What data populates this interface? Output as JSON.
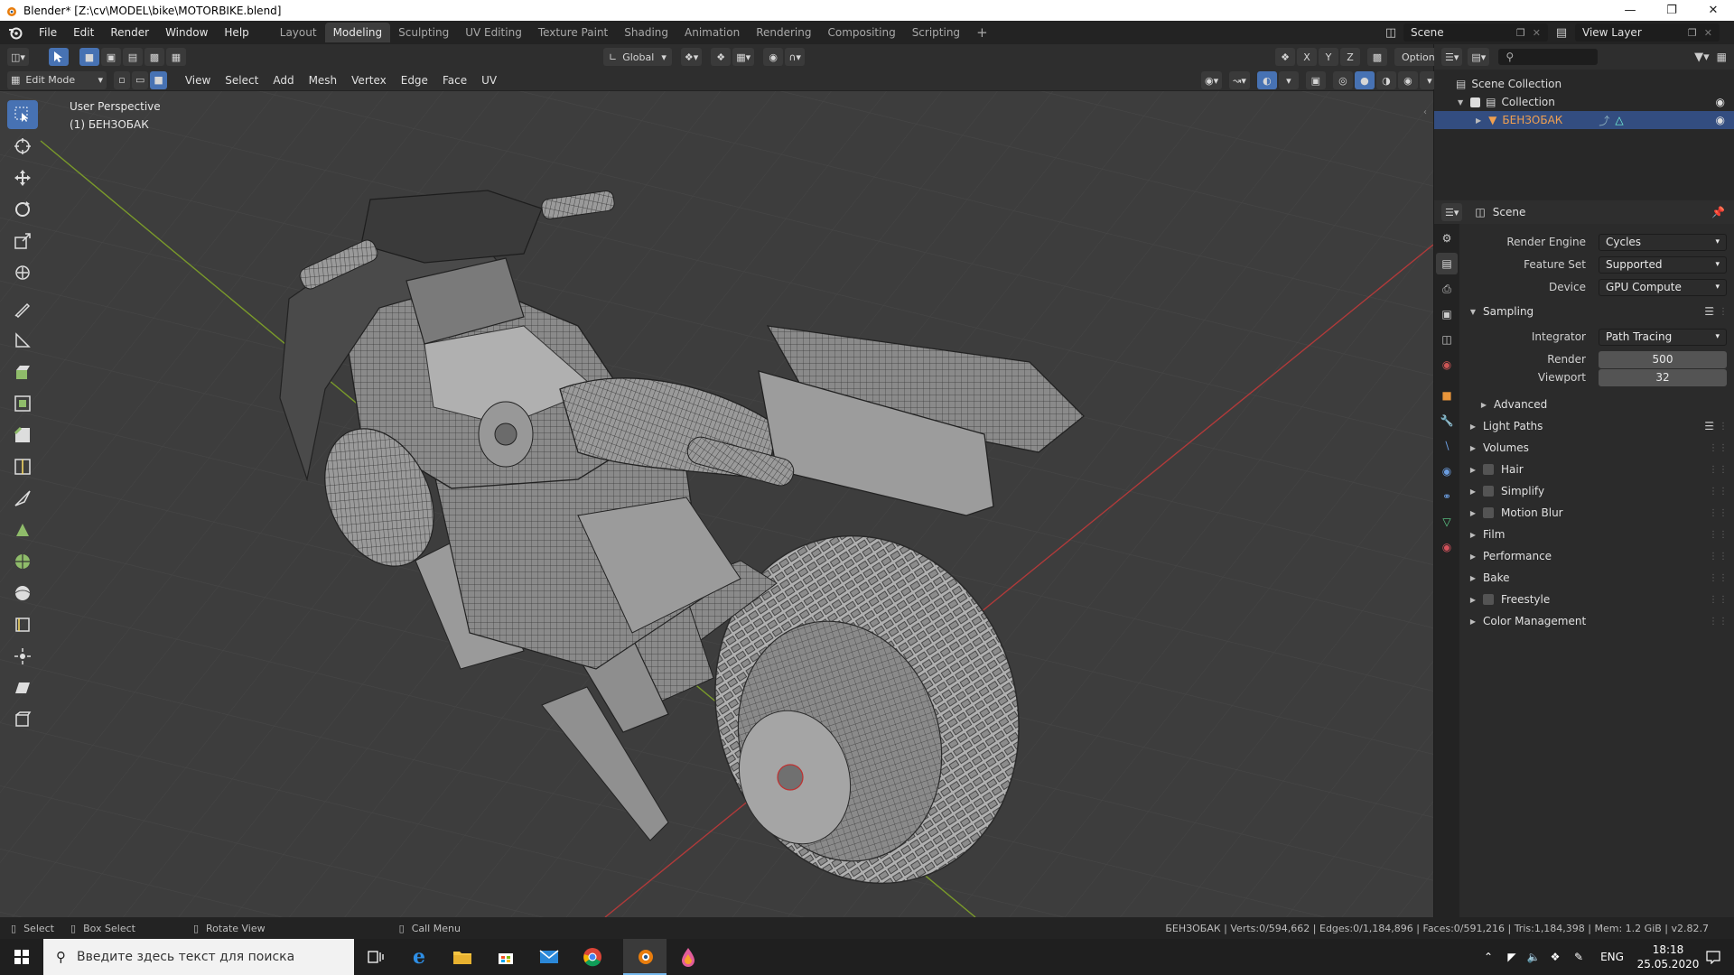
{
  "window": {
    "title": "Blender* [Z:\\cv\\MODEL\\bike\\MOTORBIKE.blend]"
  },
  "topbar": {
    "menus": [
      "File",
      "Edit",
      "Render",
      "Window",
      "Help"
    ],
    "workspaces": [
      "Layout",
      "Modeling",
      "Sculpting",
      "UV Editing",
      "Texture Paint",
      "Shading",
      "Animation",
      "Rendering",
      "Compositing",
      "Scripting"
    ],
    "active_workspace": "Modeling",
    "add_tab": "+",
    "scene_name": "Scene",
    "view_layer": "View Layer"
  },
  "viewport_header": {
    "transform_orientation": "Global",
    "axes": [
      "X",
      "Y",
      "Z"
    ],
    "options_label": "Options",
    "mode": "Edit Mode",
    "menus": [
      "View",
      "Select",
      "Add",
      "Mesh",
      "Vertex",
      "Edge",
      "Face",
      "UV"
    ]
  },
  "viewport": {
    "perspective_label": "User Perspective",
    "object_label": "(1) БЕНЗОБАК"
  },
  "outliner": {
    "scene_collection": "Scene Collection",
    "collection": "Collection",
    "object": "БЕНЗОБАК"
  },
  "properties": {
    "context": "Scene",
    "render_engine_label": "Render Engine",
    "render_engine": "Cycles",
    "feature_set_label": "Feature Set",
    "feature_set": "Supported",
    "device_label": "Device",
    "device": "GPU Compute",
    "sampling_label": "Sampling",
    "integrator_label": "Integrator",
    "integrator": "Path Tracing",
    "render_label": "Render",
    "render_samples": "500",
    "viewport_label": "Viewport",
    "viewport_samples": "32",
    "advanced_label": "Advanced",
    "panels": [
      {
        "label": "Light Paths",
        "checkbox": false
      },
      {
        "label": "Volumes",
        "checkbox": false
      },
      {
        "label": "Hair",
        "checkbox": true
      },
      {
        "label": "Simplify",
        "checkbox": true
      },
      {
        "label": "Motion Blur",
        "checkbox": true
      },
      {
        "label": "Film",
        "checkbox": false
      },
      {
        "label": "Performance",
        "checkbox": false
      },
      {
        "label": "Bake",
        "checkbox": false
      },
      {
        "label": "Freestyle",
        "checkbox": true
      },
      {
        "label": "Color Management",
        "checkbox": false
      }
    ]
  },
  "statusbar": {
    "select": "Select",
    "box_select": "Box Select",
    "rotate_view": "Rotate View",
    "call_menu": "Call Menu",
    "stats": "БЕНЗОБАК | Verts:0/594,662 | Edges:0/1,184,896 | Faces:0/591,216 | Tris:1,184,398 | Mem: 1.2 GiB | v2.82.7"
  },
  "taskbar": {
    "search_placeholder": "Введите здесь текст для поиска",
    "language": "ENG",
    "time": "18:18",
    "date": "25.05.2020"
  },
  "colors": {
    "accent": "#4772b3",
    "viewport_bg": "#3d3d3d",
    "selection": "#334d80"
  }
}
